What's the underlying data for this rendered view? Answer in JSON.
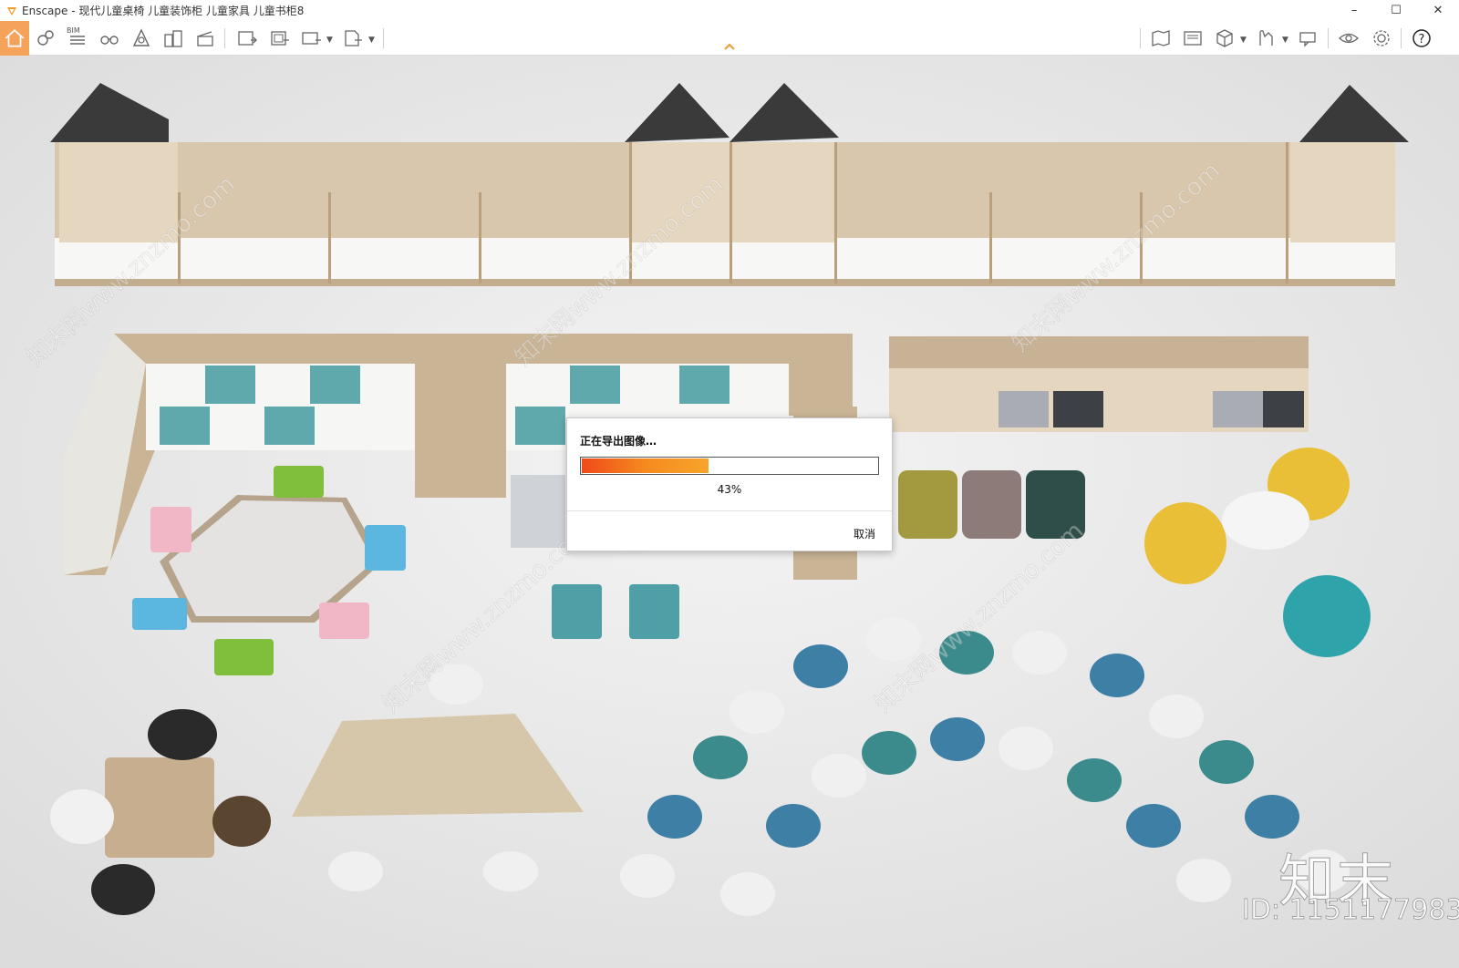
{
  "window": {
    "title": "Enscape - 现代儿童桌椅 儿童装饰柜 儿童家具 儿童书柜8"
  },
  "toolbar": {
    "bim_label": "BIM"
  },
  "dialog": {
    "title": "正在导出图像…",
    "progress_text": "43%",
    "progress_value": 0.43,
    "cancel_label": "取消"
  },
  "watermark": {
    "brand": "知末",
    "id_text": "ID: 1151177983",
    "site_text": "知末网www.znzmo.com"
  },
  "colors": {
    "accent": "#f5a25b",
    "progress_start": "#f04a1a",
    "progress_end": "#f7a52b"
  }
}
